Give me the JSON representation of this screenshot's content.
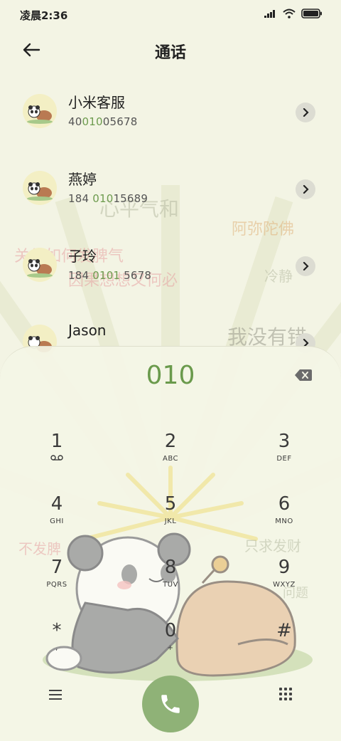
{
  "status_bar": {
    "time": "凌晨2:36"
  },
  "header": {
    "title": "通话"
  },
  "contacts": [
    {
      "name": "小米客服",
      "number_pre": "40",
      "number_hl": "010",
      "number_post": "05678"
    },
    {
      "name": "燕婷",
      "number_pre": "184 ",
      "number_hl": "010",
      "number_post": "15689"
    },
    {
      "name": "子玲",
      "number_pre": "184 ",
      "number_hl": "0101",
      "number_post": " 5678"
    },
    {
      "name": "Jason",
      "number_pre": "",
      "number_hl": "",
      "number_post": ""
    }
  ],
  "watermarks": {
    "w1": "心平气和",
    "w2": "阿弥陀佛",
    "w3": "关关如何发脾气",
    "w4": "因果想想又何必",
    "w5": "冷静",
    "w6": "我没有错",
    "w7": "不发脾",
    "w8": "只求发财",
    "w9": "问题"
  },
  "dialer": {
    "entry": "010",
    "keys": [
      {
        "digit": "1",
        "letters": ""
      },
      {
        "digit": "2",
        "letters": "ABC"
      },
      {
        "digit": "3",
        "letters": "DEF"
      },
      {
        "digit": "4",
        "letters": "GHI"
      },
      {
        "digit": "5",
        "letters": "JKL"
      },
      {
        "digit": "6",
        "letters": "MNO"
      },
      {
        "digit": "7",
        "letters": "PQRS"
      },
      {
        "digit": "8",
        "letters": "TUV"
      },
      {
        "digit": "9",
        "letters": "WXYZ"
      },
      {
        "digit": "*",
        "letters": ","
      },
      {
        "digit": "0",
        "letters": "+"
      },
      {
        "digit": "#",
        "letters": ""
      }
    ]
  },
  "colors": {
    "accent": "#6a9a4c",
    "call_button": "#8fb277",
    "background": "#f3f4e4"
  },
  "icons": {
    "back": "arrow-left-icon",
    "chevron": "chevron-right-icon",
    "backspace": "backspace-icon",
    "call": "phone-icon",
    "menu": "menu-icon",
    "dialpad": "dialpad-icon",
    "voicemail": "voicemail-icon"
  }
}
